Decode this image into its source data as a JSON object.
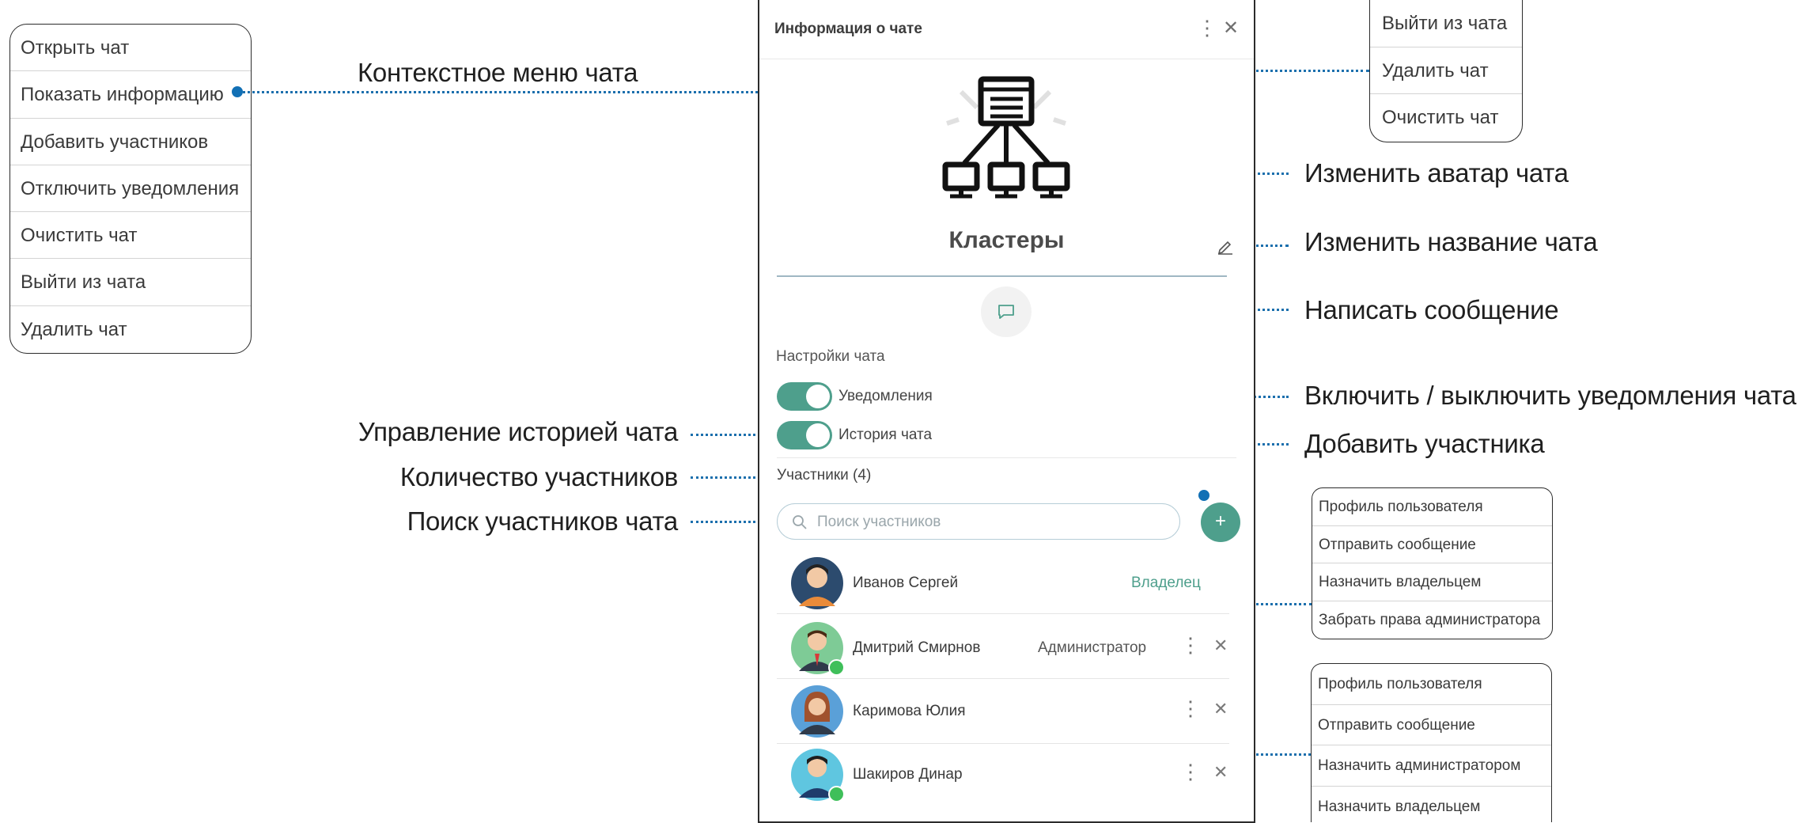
{
  "context_menu": {
    "items": [
      "Открыть чат",
      "Показать информацию",
      "Добавить участников",
      "Отключить уведомления",
      "Очистить чат",
      "Выйти из чата",
      "Удалить чат"
    ]
  },
  "chat_actions_menu": {
    "items": [
      "Выйти из чата",
      "Удалить чат",
      "Очистить чат"
    ]
  },
  "annotations": {
    "context_menu": "Контекстное меню чата",
    "change_avatar": "Изменить аватар чата",
    "rename": "Изменить название чата",
    "write_message": "Написать сообщение",
    "toggle_notifications": "Включить / выключить уведомления чата",
    "add_member": "Добавить участника",
    "history": "Управление историей чата",
    "members_count": "Количество участников",
    "search_members": "Поиск участников чата"
  },
  "panel": {
    "title": "Информация о чате",
    "chat_name": "Кластеры",
    "settings_title": "Настройки чата",
    "notifications_label": "Уведомления",
    "history_label": "История чата",
    "members_label": "Участники (4)",
    "search_placeholder": "Поиск участников",
    "add_label": "+",
    "members": [
      {
        "name": "Иванов Сергей",
        "role": "Владелец",
        "online": false
      },
      {
        "name": "Дмитрий Смирнов",
        "role": "Администратор",
        "online": true
      },
      {
        "name": "Каримова Юлия",
        "role": "",
        "online": false
      },
      {
        "name": "Шакиров Динар",
        "role": "",
        "online": true
      }
    ]
  },
  "member_menu_owner": {
    "items": [
      "Профиль пользователя",
      "Отправить сообщение",
      "Назначить владельцем",
      "Забрать права администратора"
    ]
  },
  "member_menu_regular": {
    "items": [
      "Профиль пользователя",
      "Отправить сообщение",
      "Назначить администратором",
      "Назначить владельцем"
    ]
  },
  "colors": {
    "accent": "#4e9f8c",
    "callout": "#1270b5",
    "owner_role": "#4e9f8c"
  }
}
